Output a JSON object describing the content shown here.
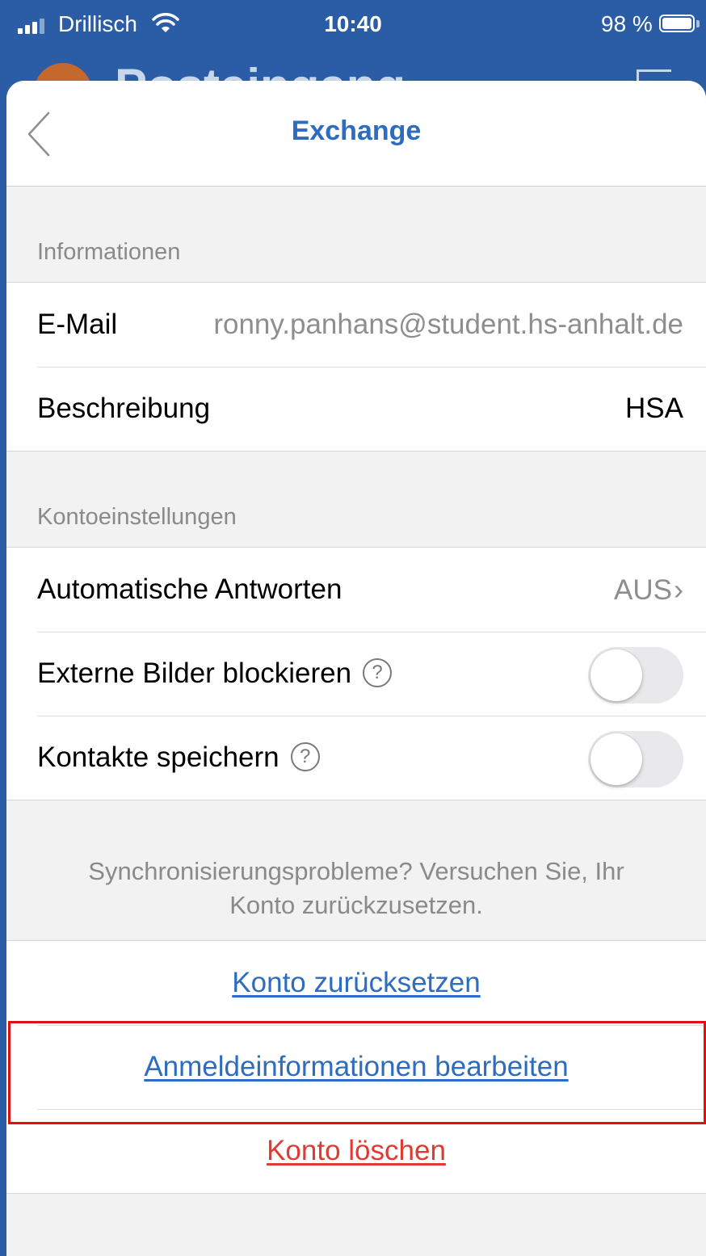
{
  "status_bar": {
    "carrier": "Drillisch",
    "time": "10:40",
    "battery": "98 %"
  },
  "background": {
    "title": "Posteingang"
  },
  "nav": {
    "title": "Exchange"
  },
  "info_section": {
    "header": "Informationen",
    "email_label": "E-Mail",
    "email_value": "ronny.panhans@student.hs-anhalt.de",
    "description_label": "Beschreibung",
    "description_value": "HSA"
  },
  "account_settings": {
    "header": "Kontoeinstellungen",
    "auto_reply_label": "Automatische Antworten",
    "auto_reply_value": "AUS",
    "block_images_label": "Externe Bilder blockieren",
    "block_images_on": false,
    "save_contacts_label": "Kontakte speichern",
    "save_contacts_on": false,
    "help_symbol": "?"
  },
  "sync_hint": {
    "line1": "Synchronisierungsprobleme? Versuchen Sie, Ihr",
    "line2": "Konto zurückzusetzen."
  },
  "actions": {
    "reset_account": "Konto zurücksetzen",
    "edit_credentials": "Anmeldeinformationen bearbeiten",
    "delete_account": "Konto löschen"
  },
  "colors": {
    "accent_blue": "#2d6cc0",
    "delete_red": "#e03a32",
    "highlight_red": "#e01010"
  }
}
